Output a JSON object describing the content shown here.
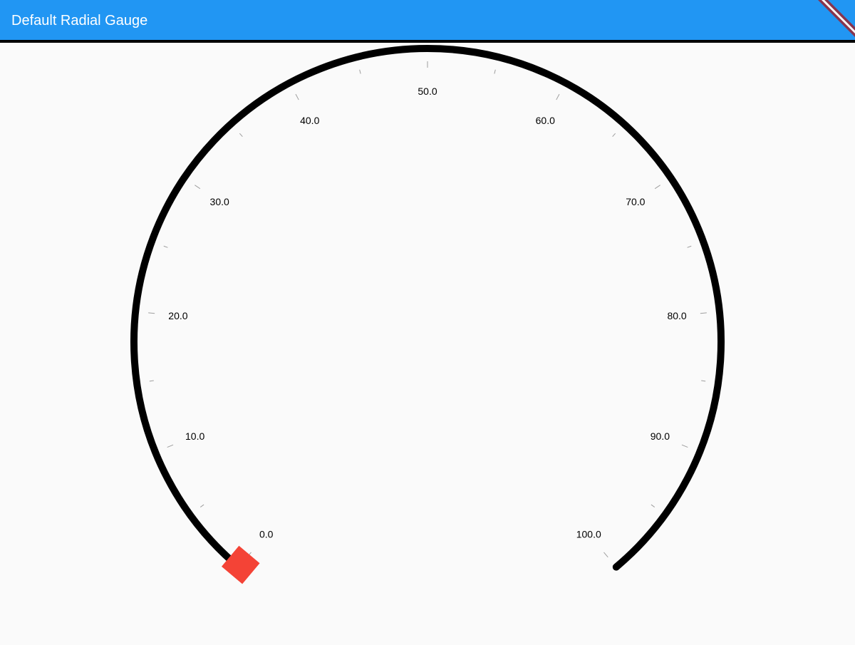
{
  "app_bar": {
    "title": "Default Radial Gauge"
  },
  "colors": {
    "app_bar": "#2196f3",
    "background": "#fafafa",
    "axis_line": "#000000",
    "marker": "#f44336",
    "tick": "#9e9e9e",
    "label": "#000000",
    "debug_banner": "#88354e"
  },
  "chart_data": {
    "type": "radial-gauge",
    "axis": {
      "min": 0,
      "max": 100,
      "start_angle_deg": 130,
      "sweep_angle_deg": 280,
      "major_interval": 10,
      "minor_interval": 5
    },
    "labels": [
      "0.0",
      "10.0",
      "20.0",
      "30.0",
      "40.0",
      "50.0",
      "60.0",
      "70.0",
      "80.0",
      "90.0",
      "100.0"
    ],
    "pointer": {
      "shape": "square-marker",
      "value": 0
    }
  }
}
